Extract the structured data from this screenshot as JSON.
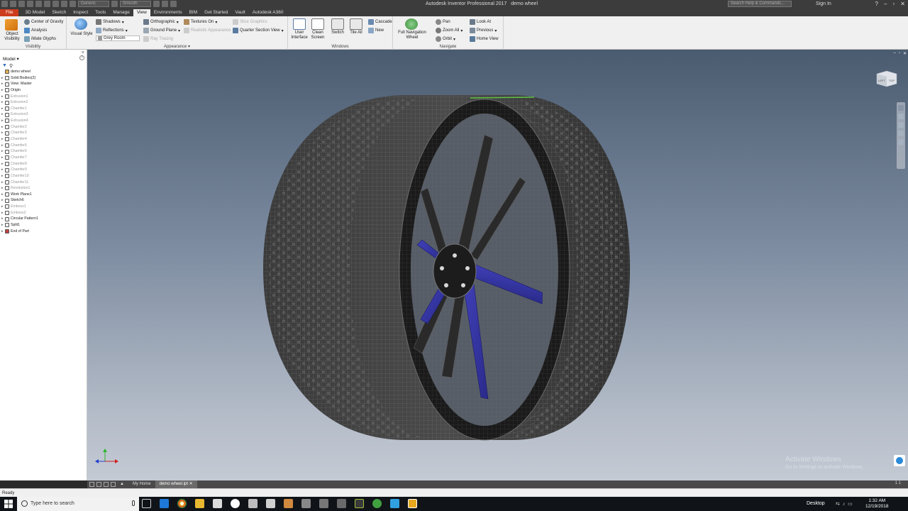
{
  "titlebar": {
    "style_select": "Generic",
    "visual_select": "Smooth",
    "app_title": "Autodesk Inventor Professional 2017",
    "doc_title": "demo wheel",
    "search_placeholder": "Search Help & Commands...",
    "sign_in": "Sign In",
    "help": "?"
  },
  "tabs": [
    "File",
    "3D Model",
    "Sketch",
    "Inspect",
    "Tools",
    "Manage",
    "View",
    "Environments",
    "BIM",
    "Get Started",
    "Vault",
    "Autodesk A360"
  ],
  "active_tab": "View",
  "ribbon": {
    "visibility": {
      "label": "Visibility",
      "object_visibility_1": "Object",
      "object_visibility_2": "Visibility",
      "cog": "Center of Gravity",
      "analysis": "Analysis",
      "imate": "iMate Glyphs"
    },
    "appearance": {
      "label": "Appearance",
      "visual_style": "Visual Style",
      "shadows": "Shadows",
      "reflections": "Reflections",
      "grey_room": "Grey Room",
      "ray_tracing": "Ray Tracing",
      "orthographic": "Orthographic",
      "ground_plane": "Ground Plane",
      "textures_on": "Textures On",
      "realistic_appearance": "Realistic Appearance",
      "slice_graphics": "Slice Graphics",
      "quarter_section": "Quarter Section View"
    },
    "windows": {
      "label": "Windows",
      "user_interface_1": "User",
      "user_interface_2": "Interface",
      "clean_screen_1": "Clean",
      "clean_screen_2": "Screen",
      "switch": "Switch",
      "tile_all": "Tile All",
      "cascade": "Cascade",
      "new": "New"
    },
    "navigate": {
      "label": "Navigate",
      "full_nav_1": "Full Navigation",
      "full_nav_2": "Wheel",
      "pan": "Pan",
      "zoom_all": "Zoom All",
      "orbit": "Orbit",
      "look_at": "Look At",
      "previous": "Previous",
      "home_view": "Home View"
    }
  },
  "browser": {
    "title": "Model",
    "items": [
      {
        "label": "demo wheel",
        "dim": false
      },
      {
        "label": "Solid Bodies(2)",
        "dim": false
      },
      {
        "label": "View: Master",
        "dim": false
      },
      {
        "label": "Origin",
        "dim": false
      },
      {
        "label": "Extrusion1",
        "dim": true
      },
      {
        "label": "Extrusion2",
        "dim": true
      },
      {
        "label": "Chamfer1",
        "dim": true
      },
      {
        "label": "Extrusion3",
        "dim": true
      },
      {
        "label": "Extrusion4",
        "dim": true
      },
      {
        "label": "Chamfer2",
        "dim": true
      },
      {
        "label": "Chamfer3",
        "dim": true
      },
      {
        "label": "Chamfer4",
        "dim": true
      },
      {
        "label": "Chamfer5",
        "dim": true
      },
      {
        "label": "Chamfer6",
        "dim": true
      },
      {
        "label": "Chamfer7",
        "dim": true
      },
      {
        "label": "Chamfer8",
        "dim": true
      },
      {
        "label": "Chamfer9",
        "dim": true
      },
      {
        "label": "Chamfer10",
        "dim": true
      },
      {
        "label": "Chamfer11",
        "dim": true
      },
      {
        "label": "Revolution1",
        "dim": true
      },
      {
        "label": "Work Plane1",
        "dim": false
      },
      {
        "label": "Sketch6",
        "dim": false
      },
      {
        "label": "Emboss1",
        "dim": true
      },
      {
        "label": "Emboss2",
        "dim": true
      },
      {
        "label": "Circular Pattern1",
        "dim": false
      },
      {
        "label": "Split1",
        "dim": false
      },
      {
        "label": "End of Part",
        "dim": false
      }
    ]
  },
  "viewcube": {
    "left": "LEFT",
    "top": "TOP"
  },
  "watermark": {
    "line1": "Activate Windows",
    "line2": "Go to Settings to activate Windows."
  },
  "doctabs": {
    "home": "My Home",
    "doc": "demo wheel.ipt",
    "pager": "1   1"
  },
  "status": {
    "text": "Ready"
  },
  "taskbar": {
    "search_placeholder": "Type here to search",
    "desktop": "Desktop",
    "time": "1:32 AM",
    "date": "12/19/2018"
  }
}
